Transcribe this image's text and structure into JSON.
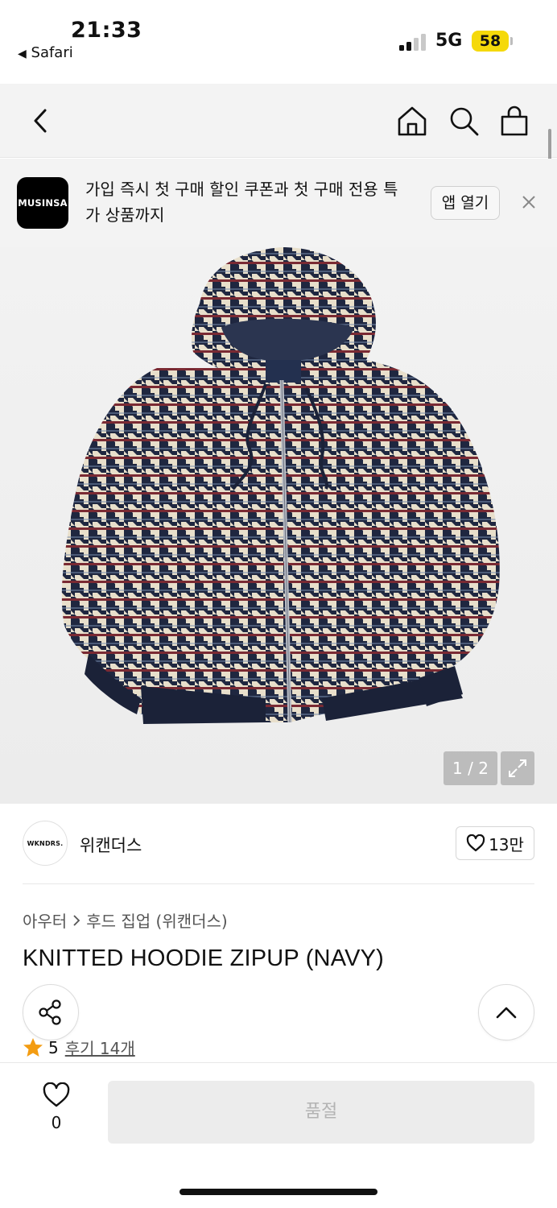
{
  "status_bar": {
    "time": "21:33",
    "back_app": "Safari",
    "network": "5G",
    "battery": "58",
    "battery_color": "#F5D90A"
  },
  "nav": {
    "icons": [
      "back-chevron-icon",
      "home-icon",
      "search-icon",
      "shopping-bag-icon"
    ]
  },
  "banner": {
    "logo_text": "MUSINSA",
    "message_line1": "가입 즉시 첫 구매 할인 쿠폰과 첫 구매 전용 특",
    "message_line2": "가 상품까지",
    "open_app_label": "앱 열기"
  },
  "gallery": {
    "counter": "1 / 2"
  },
  "brand": {
    "logo_text": "WKNDRS.",
    "name": "위캔더스",
    "like_count": "13만"
  },
  "product": {
    "breadcrumb_category": "아우터",
    "breadcrumb_subcategory": "후드 집업 (위캔더스)",
    "title": "KNITTED HOODIE ZIPUP (NAVY)",
    "rating": "5",
    "reviews": "후기 14개"
  },
  "bottom_bar": {
    "like_count": "0",
    "soldout_label": "품절"
  },
  "colors": {
    "star": "#F39C12",
    "jacket_navy": "#1F2740",
    "jacket_cream": "#E8DFCB",
    "jacket_red": "#7A2A33"
  }
}
